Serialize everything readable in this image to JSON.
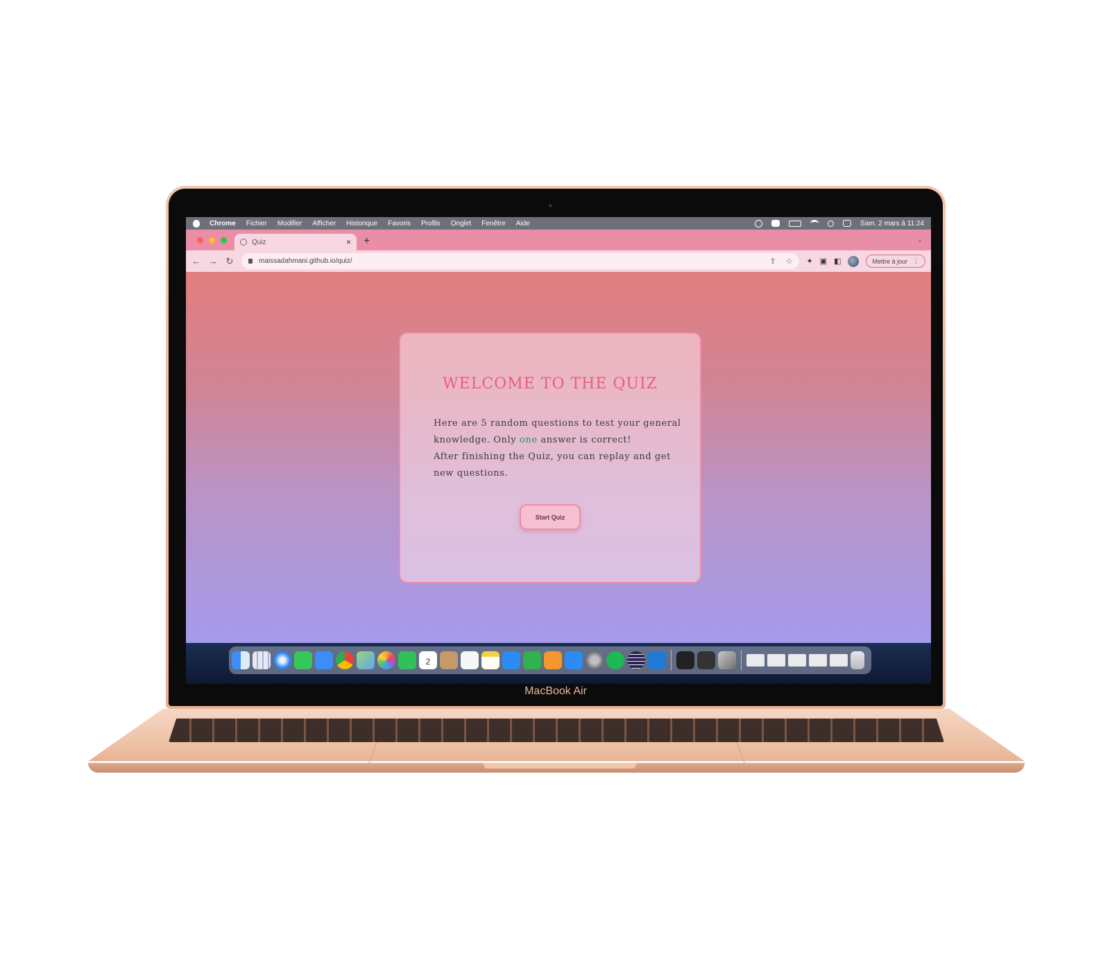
{
  "device": {
    "label": "MacBook Air"
  },
  "menubar": {
    "app": "Chrome",
    "items": [
      "Fichier",
      "Modifier",
      "Afficher",
      "Historique",
      "Favoris",
      "Profils",
      "Onglet",
      "Fenêtre",
      "Aide"
    ],
    "clock": "Sam. 2 mars à 11:24"
  },
  "browser": {
    "tab_title": "Quiz",
    "tab_close": "×",
    "new_tab": "+",
    "url": "maissadahmani.github.io/quiz/",
    "update_label": "Mettre à jour"
  },
  "quiz": {
    "title": "WELCOME TO THE QUIZ",
    "intro_line1": "Here are 5 random questions to test your general knowledge. Only ",
    "intro_emphasis": "one",
    "intro_line2": " answer is correct!",
    "intro_line3": "After finishing the Quiz, you can replay and get new questions.",
    "start_button": "Start Quiz"
  },
  "colors": {
    "page_gradient_top": "#e27e7e",
    "page_gradient_bottom": "#a59aeb",
    "title_color": "#ec5b7f",
    "emphasis_color": "#2f8d62",
    "tab_strip": "#ea8ea8"
  },
  "dock": {
    "icons": [
      "finder-icon",
      "launchpad-icon",
      "safari-icon",
      "messages-icon",
      "mail-icon",
      "chrome-icon",
      "maps-icon",
      "photos-icon",
      "facetime-icon",
      "calendar-icon",
      "contacts-icon",
      "reminders-icon",
      "notes-icon",
      "keynote-icon",
      "numbers-icon",
      "pages-icon",
      "app-store-icon",
      "system-preferences-icon",
      "spotify-icon",
      "eclipse-icon",
      "vscode-icon",
      "terminal-icon",
      "activity-monitor-icon",
      "preview-icon"
    ],
    "calendar_day": "2"
  }
}
